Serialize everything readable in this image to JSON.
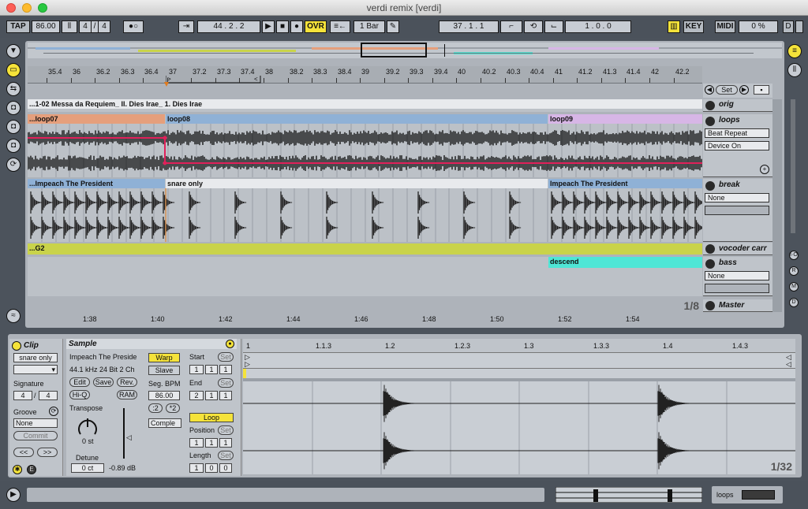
{
  "window": {
    "title": "verdi remix  [verdi]"
  },
  "control_bar": {
    "tap": "TAP",
    "tempo": "86.00",
    "signature_num": "4",
    "signature_den": "4",
    "position": "44 .  2 .  2",
    "ovr": "OVR",
    "quantize": "1 Bar",
    "loop_start": "37 .  1 .  1",
    "loop_length": "1 .  0 .  0",
    "key": "KEY",
    "midi": "MIDI",
    "cpu": "0 %",
    "d": "D"
  },
  "arrangement": {
    "ruler_ticks": [
      "35.4",
      "36",
      "36.2",
      "36.3",
      "36.4",
      "37",
      "37.2",
      "37.3",
      "37.4",
      "38",
      "38.2",
      "38.3",
      "38.4",
      "39",
      "39.2",
      "39.3",
      "39.4",
      "40",
      "40.2",
      "40.3",
      "40.4",
      "41",
      "41.2",
      "41.3",
      "41.4",
      "42",
      "42.2"
    ],
    "set_label": "Set",
    "time_ticks": [
      "1:38",
      "1:40",
      "1:42",
      "1:44",
      "1:46",
      "1:48",
      "1:50",
      "1:52",
      "1:54"
    ],
    "zoom_ratio": "1/8",
    "tracks": [
      {
        "name": "orig",
        "clips": [
          {
            "label": "...1-02 Messa da Requiem_ II. Dies Irae_ 1. Dies Irae",
            "color": "#e8eaed"
          }
        ]
      },
      {
        "name": "loops",
        "clips": [
          {
            "label": "...loop07",
            "color": "#e59f7c"
          },
          {
            "label": "loop08",
            "color": "#8fb1d6"
          },
          {
            "label": "loop09",
            "color": "#d7b6e6"
          }
        ],
        "devices": [
          "Beat Repeat",
          "Device On"
        ]
      },
      {
        "name": "break",
        "clips": [
          {
            "label": "...Impeach The President",
            "color": "#8fb1d6"
          },
          {
            "label": "snare only",
            "color": "#e8eaed"
          },
          {
            "label": "Impeach The President",
            "color": "#8fb1d6"
          }
        ],
        "dropdown": "None"
      },
      {
        "name": "vocoder carr",
        "clips": [
          {
            "label": "...G2",
            "color": "#c9d34a"
          }
        ]
      },
      {
        "name": "bass",
        "clips": [
          {
            "label": "descend",
            "color": "#4fe6d6"
          }
        ],
        "dropdown": "None"
      },
      {
        "name": "Master"
      }
    ]
  },
  "clip_panel": {
    "title": "Clip",
    "name": "snare only",
    "signature_label": "Signature",
    "sig_num": "4",
    "sig_den": "4",
    "groove_label": "Groove",
    "groove_value": "None",
    "commit": "Commit",
    "nav_left": "<<",
    "nav_right": ">>"
  },
  "sample_panel": {
    "title": "Sample",
    "file": "Impeach The Preside",
    "info": "44.1 kHz 24 Bit 2 Ch",
    "edit": "Edit",
    "save": "Save",
    "rev": "Rev.",
    "hiq": "Hi-Q",
    "ram": "RAM",
    "warp": "Warp",
    "slave": "Slave",
    "seg_bpm_label": "Seg. BPM",
    "seg_bpm": "86.00",
    "half": ":2",
    "double": "*2",
    "mode": "Comple",
    "transpose_label": "Transpose",
    "transpose_value": "0 st",
    "detune_label": "Detune",
    "detune_value": "0 ct",
    "gain": "-0.89 dB",
    "start_label": "Start",
    "start": [
      "1",
      "1",
      "1"
    ],
    "end_label": "End",
    "end": [
      "2",
      "1",
      "1"
    ],
    "loop": "Loop",
    "position_label": "Position",
    "position": [
      "1",
      "1",
      "1"
    ],
    "length_label": "Length",
    "length": [
      "1",
      "0",
      "0"
    ],
    "set": "Set"
  },
  "clip_editor": {
    "ruler_ticks": [
      "1",
      "1.1.3",
      "1.2",
      "1.2.3",
      "1.3",
      "1.3.3",
      "1.4",
      "1.4.3"
    ],
    "zoom_ratio": "1/32"
  },
  "status": {
    "track_label": "loops"
  }
}
